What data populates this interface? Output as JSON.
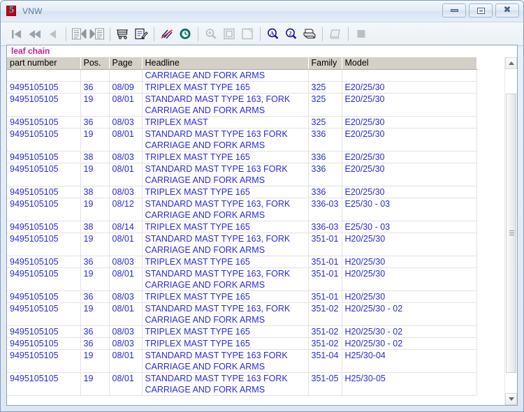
{
  "window": {
    "title": "VNW",
    "app_icon": "app-5-icon",
    "controls": {
      "minimize": "minimize-button",
      "maximize": "maximize-button",
      "close": "close-button"
    }
  },
  "toolbar": {
    "items": [
      {
        "name": "first-record-icon",
        "enabled": false
      },
      {
        "name": "fast-rewind-icon",
        "enabled": false
      },
      {
        "name": "previous-record-icon",
        "enabled": false
      },
      {
        "name": "sep"
      },
      {
        "name": "document-first-icon",
        "enabled": false
      },
      {
        "name": "document-last-icon",
        "enabled": false
      },
      {
        "name": "sep"
      },
      {
        "name": "shopping-cart-icon",
        "enabled": true
      },
      {
        "name": "edit-order-icon",
        "enabled": true
      },
      {
        "name": "sep"
      },
      {
        "name": "no-hatch-icon",
        "enabled": true
      },
      {
        "name": "clock-globe-icon",
        "enabled": true
      },
      {
        "name": "sep"
      },
      {
        "name": "zoom-in-icon",
        "enabled": false
      },
      {
        "name": "page-view-icon",
        "enabled": false
      },
      {
        "name": "page-blank-icon",
        "enabled": false
      },
      {
        "name": "sep"
      },
      {
        "name": "zoom-a-icon",
        "enabled": true
      },
      {
        "name": "zoom-2-icon",
        "enabled": true
      },
      {
        "name": "print-icon",
        "enabled": true
      },
      {
        "name": "sep"
      },
      {
        "name": "notepad-icon",
        "enabled": false
      },
      {
        "name": "sep"
      },
      {
        "name": "stop-icon",
        "enabled": false
      }
    ]
  },
  "panel": {
    "section_title": "leaf chain"
  },
  "table": {
    "columns": [
      {
        "key": "part_number",
        "label": "part number"
      },
      {
        "key": "pos",
        "label": "Pos."
      },
      {
        "key": "page",
        "label": "Page"
      },
      {
        "key": "headline",
        "label": "Headline"
      },
      {
        "key": "family",
        "label": "Family"
      },
      {
        "key": "model",
        "label": "Model"
      }
    ],
    "rows": [
      {
        "part_number": "",
        "pos": "",
        "page": "",
        "headline": "CARRIAGE AND FORK ARMS",
        "family": "",
        "model": ""
      },
      {
        "part_number": "9495105105",
        "pos": "36",
        "page": "08/09",
        "headline": "TRIPLEX MAST TYPE 165",
        "family": "325",
        "model": "E20/25/30"
      },
      {
        "part_number": "9495105105",
        "pos": "19",
        "page": "08/01",
        "headline": "STANDARD MAST TYPE 163, FORK\nCARRIAGE AND FORK ARMS",
        "family": "325",
        "model": "E20/25/30"
      },
      {
        "part_number": "9495105105",
        "pos": "36",
        "page": "08/03",
        "headline": "TRIPLEX MAST",
        "family": "325",
        "model": "E20/25/30"
      },
      {
        "part_number": "9495105105",
        "pos": "19",
        "page": "08/01",
        "headline": "STANDARD MAST TYPE 163  FORK\nCARRIAGE AND FORK ARMS",
        "family": "336",
        "model": "E20/25/30"
      },
      {
        "part_number": "9495105105",
        "pos": "38",
        "page": "08/03",
        "headline": "TRIPLEX MAST TYPE 165",
        "family": "336",
        "model": "E20/25/30"
      },
      {
        "part_number": "9495105105",
        "pos": "19",
        "page": "08/01",
        "headline": "STANDARD MAST TYPE 163  FORK\nCARRIAGE AND FORK ARMS",
        "family": "336",
        "model": "E20/25/30"
      },
      {
        "part_number": "9495105105",
        "pos": "38",
        "page": "08/03",
        "headline": "TRIPLEX MAST TYPE 165",
        "family": "336",
        "model": "E20/25/30"
      },
      {
        "part_number": "9495105105",
        "pos": "19",
        "page": "08/12",
        "headline": "STANDARD MAST TYPE 163, FORK\nCARRIAGE AND FORK ARMS",
        "family": "336-03",
        "model": "E25/30 - 03"
      },
      {
        "part_number": "9495105105",
        "pos": "38",
        "page": "08/14",
        "headline": "TRIPLEX MAST TYPE 165",
        "family": "336-03",
        "model": "E25/30 - 03"
      },
      {
        "part_number": "9495105105",
        "pos": "19",
        "page": "08/01",
        "headline": "STANDARD MAST TYPE 163, FORK\nCARRIAGE AND FORK ARMS",
        "family": "351-01",
        "model": "H20/25/30"
      },
      {
        "part_number": "9495105105",
        "pos": "36",
        "page": "08/03",
        "headline": "TRIPLEX MAST TYPE 165",
        "family": "351-01",
        "model": "H20/25/30"
      },
      {
        "part_number": "9495105105",
        "pos": "19",
        "page": "08/01",
        "headline": "STANDARD MAST TYPE 163, FORK\nCARRIAGE AND FORK ARMS",
        "family": "351-01",
        "model": "H20/25/30"
      },
      {
        "part_number": "9495105105",
        "pos": "36",
        "page": "08/03",
        "headline": "TRIPLEX MAST TYPE 165",
        "family": "351-01",
        "model": "H20/25/30"
      },
      {
        "part_number": "9495105105",
        "pos": "19",
        "page": "08/01",
        "headline": "STANDARD MAST TYPE 163, FORK\nCARRIAGE AND FORK ARMS",
        "family": "351-02",
        "model": "H20/25/30 - 02"
      },
      {
        "part_number": "9495105105",
        "pos": "36",
        "page": "08/03",
        "headline": "TRIPLEX MAST TYPE 165",
        "family": "351-02",
        "model": "H20/25/30 - 02"
      },
      {
        "part_number": "9495105105",
        "pos": "36",
        "page": "08/03",
        "headline": "TRIPLEX MAST TYPE 165",
        "family": "351-02",
        "model": "H20/25/30 - 02"
      },
      {
        "part_number": "9495105105",
        "pos": "19",
        "page": "08/01",
        "headline": "STANDARD MAST TYPE 163 FORK\nCARRIAGE AND FORK ARMS",
        "family": "351-04",
        "model": "H25/30-04"
      },
      {
        "part_number": "9495105105",
        "pos": "19",
        "page": "08/01",
        "headline": "STANDARD MAST TYPE 163 FORK\nCARRIAGE AND FORK ARMS",
        "family": "351-05",
        "model": "H25/30-05"
      }
    ]
  },
  "scrollbar": {
    "up_icon": "scroll-up-arrow-icon",
    "down_icon": "scroll-down-arrow-icon",
    "thumb": "scroll-thumb"
  },
  "colors": {
    "section_title": "#c020a0",
    "link_text": "#2a2adf",
    "header_bg": "#d4d0c8"
  }
}
